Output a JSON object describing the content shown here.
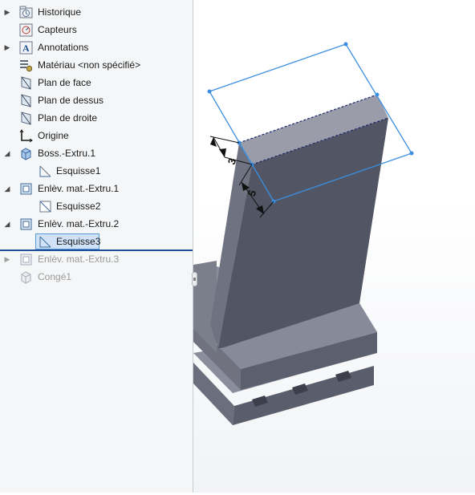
{
  "feature_tree": {
    "items": [
      {
        "label": "Historique",
        "icon": "history-folder-icon",
        "expandable": true
      },
      {
        "label": "Capteurs",
        "icon": "sensors-icon",
        "expandable": false
      },
      {
        "label": "Annotations",
        "icon": "annotations-icon",
        "expandable": true
      },
      {
        "label": "Matériau <non spécifié>",
        "icon": "material-icon",
        "expandable": false
      },
      {
        "label": "Plan de face",
        "icon": "plane-icon",
        "expandable": false
      },
      {
        "label": "Plan de dessus",
        "icon": "plane-icon",
        "expandable": false
      },
      {
        "label": "Plan de droite",
        "icon": "plane-icon",
        "expandable": false
      },
      {
        "label": "Origine",
        "icon": "origin-icon",
        "expandable": false
      },
      {
        "label": "Boss.-Extru.1",
        "icon": "boss-extrude-icon",
        "expanded": true
      },
      {
        "label": "Esquisse1",
        "icon": "sketch-icon",
        "child": true
      },
      {
        "label": "Enlèv. mat.-Extru.1",
        "icon": "cut-extrude-icon",
        "expanded": true
      },
      {
        "label": "Esquisse2",
        "icon": "sketch-icon",
        "child": true
      },
      {
        "label": "Enlèv. mat.-Extru.2",
        "icon": "cut-extrude-icon",
        "expanded": true
      },
      {
        "label": "Esquisse3",
        "icon": "sketch-icon",
        "child": true,
        "selected": true
      },
      {
        "label": "Enlèv. mat.-Extru.3",
        "icon": "cut-extrude-icon",
        "suppressed": true,
        "expandable": true
      },
      {
        "label": "Congé1",
        "icon": "fillet-icon",
        "suppressed": true
      }
    ]
  },
  "viewport": {
    "dimensions": [
      "3",
      "5"
    ]
  },
  "colors": {
    "sketch_blue": "#3b8fe0",
    "selection_fill": "#cfe2f7",
    "rollback_bar": "#1f4e9c",
    "model_gray": "#5f6270"
  }
}
